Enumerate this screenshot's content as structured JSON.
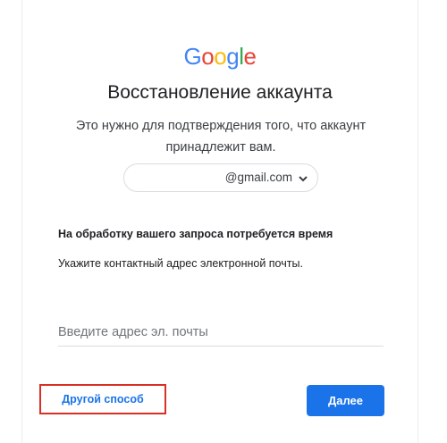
{
  "logo": {
    "letters": [
      "G",
      "o",
      "o",
      "g",
      "l",
      "e"
    ],
    "colors": [
      "#4285F4",
      "#EA4335",
      "#FBBC05",
      "#4285F4",
      "#34A853",
      "#EA4335"
    ]
  },
  "heading": "Восстановление аккаунта",
  "subtitle": "Это нужно для подтверждения того, что аккаунт принадлежит вам.",
  "account": {
    "email": "@gmail.com",
    "dropdown_icon": "chevron-down-icon"
  },
  "section": {
    "title": "На обработку вашего запроса потребуется время",
    "text": "Укажите контактный адрес электронной почты."
  },
  "email_input": {
    "placeholder": "Введите адрес эл. почты",
    "value": ""
  },
  "actions": {
    "other_way": "Другой способ",
    "next": "Далее",
    "highlight_color": "#d93025",
    "primary_color": "#1a73e8"
  }
}
